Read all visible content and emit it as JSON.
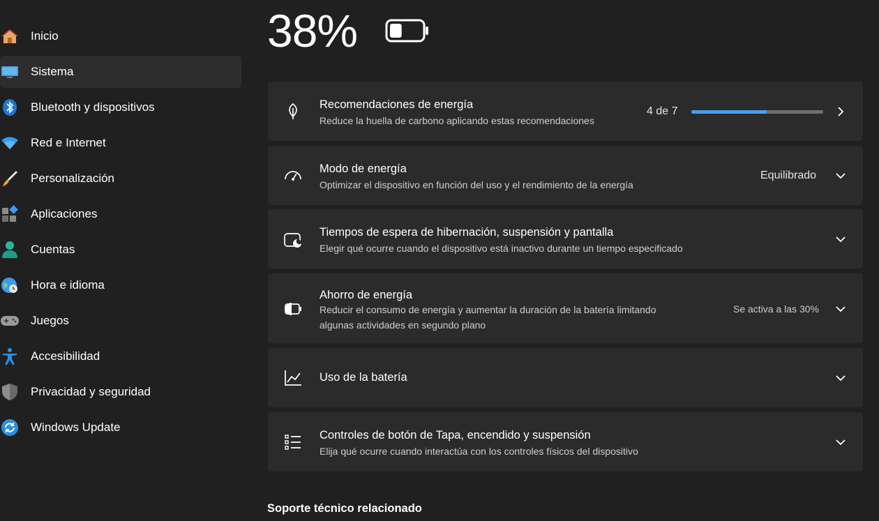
{
  "sidebar": {
    "items": [
      {
        "label": "Inicio",
        "icon": "home-icon"
      },
      {
        "label": "Sistema",
        "icon": "monitor-icon",
        "active": true
      },
      {
        "label": "Bluetooth y dispositivos",
        "icon": "bluetooth-icon"
      },
      {
        "label": "Red e Internet",
        "icon": "wifi-icon"
      },
      {
        "label": "Personalización",
        "icon": "brush-icon"
      },
      {
        "label": "Aplicaciones",
        "icon": "apps-icon"
      },
      {
        "label": "Cuentas",
        "icon": "account-icon"
      },
      {
        "label": "Hora e idioma",
        "icon": "globe-clock-icon"
      },
      {
        "label": "Juegos",
        "icon": "gamepad-icon"
      },
      {
        "label": "Accesibilidad",
        "icon": "accessibility-icon"
      },
      {
        "label": "Privacidad y seguridad",
        "icon": "shield-icon"
      },
      {
        "label": "Windows Update",
        "icon": "update-icon"
      }
    ]
  },
  "battery": {
    "percent_label": "38%",
    "level": 0.38
  },
  "cards": {
    "recommendations": {
      "title": "Recomendaciones de energía",
      "desc": "Reduce la huella de carbono aplicando estas recomendaciones",
      "progress_label": "4 de 7",
      "progress_value": 4,
      "progress_max": 7
    },
    "power_mode": {
      "title": "Modo de energía",
      "desc": "Optimizar el dispositivo en función del uso y el rendimiento de la energía",
      "value": "Equilibrado"
    },
    "timeouts": {
      "title": "Tiempos de espera de hibernación, suspensión y pantalla",
      "desc": "Elegir qué ocurre cuando el dispositivo está inactivo durante un tiempo especificado"
    },
    "saver": {
      "title": "Ahorro de energía",
      "desc_line1": "Reducir el consumo de energía y aumentar la duración de la batería limitando",
      "desc_line2": "algunas actividades en segundo plano",
      "status": "Se activa a las 30%"
    },
    "usage": {
      "title": "Uso de la batería"
    },
    "lid": {
      "title": "Controles de botón de Tapa, encendido y suspensión",
      "desc": "Elija qué ocurre cuando interactúa con los controles físicos del dispositivo"
    }
  },
  "related_support": {
    "heading": "Soporte técnico relacionado"
  },
  "colors": {
    "background": "#202020",
    "card": "#2b2b2b",
    "accent": "#4c9fe8"
  }
}
